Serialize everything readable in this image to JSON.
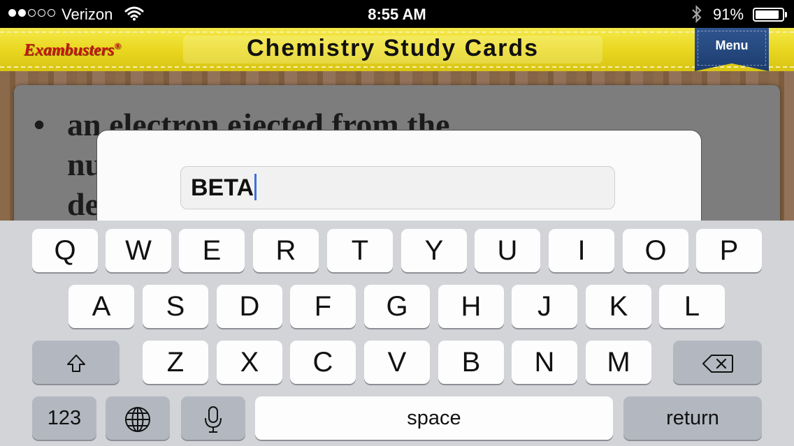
{
  "status_bar": {
    "carrier": "Verizon",
    "time": "8:55 AM",
    "battery_percent": "91%",
    "battery_level": 0.91,
    "signal_bars_filled": 2,
    "signal_bars_total": 5,
    "icons": [
      "wifi-icon",
      "bluetooth-icon",
      "battery-icon"
    ]
  },
  "header": {
    "brand": "Exambusters",
    "brand_mark": "®",
    "title": "Chemistry Study Cards",
    "menu_label": "Menu",
    "colors": {
      "banner": "#e9d720",
      "brand": "#c8141a",
      "menu": "#1c3c6e"
    }
  },
  "card": {
    "bullet": "•",
    "lines": [
      "an electron ejected from the",
      "nu",
      "de"
    ]
  },
  "dialog": {
    "input_value": "BETA"
  },
  "keyboard": {
    "row1": [
      "Q",
      "W",
      "E",
      "R",
      "T",
      "Y",
      "U",
      "I",
      "O",
      "P"
    ],
    "row2": [
      "A",
      "S",
      "D",
      "F",
      "G",
      "H",
      "J",
      "K",
      "L"
    ],
    "row3": [
      "Z",
      "X",
      "C",
      "V",
      "B",
      "N",
      "M"
    ],
    "numbers_label": "123",
    "space_label": "space",
    "return_label": "return",
    "icons": [
      "shift-icon",
      "backspace-icon",
      "globe-icon",
      "microphone-icon"
    ]
  }
}
